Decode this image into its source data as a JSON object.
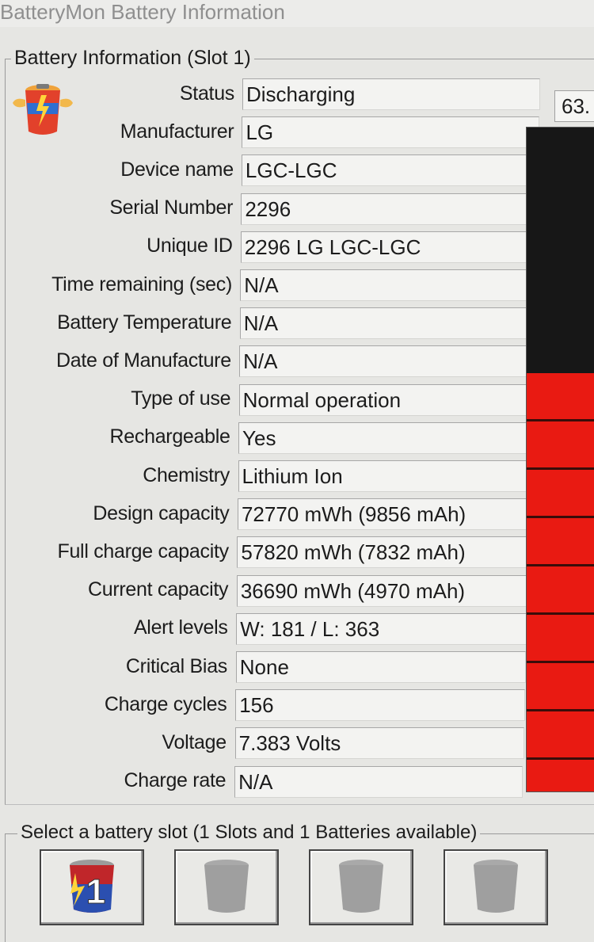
{
  "window": {
    "title": "BatteryMon Battery Information"
  },
  "info_group": {
    "title": "Battery Information (Slot 1)"
  },
  "percentage": "63.",
  "charge_level": 0.63,
  "fields": [
    {
      "label": "Status",
      "value": "Discharging"
    },
    {
      "label": "Manufacturer",
      "value": "LG"
    },
    {
      "label": "Device name",
      "value": "LGC-LGC"
    },
    {
      "label": "Serial Number",
      "value": "2296"
    },
    {
      "label": "Unique ID",
      "value": "2296 LG LGC-LGC"
    },
    {
      "label": "Time remaining (sec)",
      "value": "N/A"
    },
    {
      "label": "Battery Temperature",
      "value": "N/A"
    },
    {
      "label": "Date of Manufacture",
      "value": "N/A"
    },
    {
      "label": "Type of use",
      "value": "Normal operation"
    },
    {
      "label": "Rechargeable",
      "value": "Yes"
    },
    {
      "label": "Chemistry",
      "value": "Lithium Ion"
    },
    {
      "label": "Design capacity",
      "value": "72770 mWh (9856 mAh)"
    },
    {
      "label": "Full charge capacity",
      "value": "57820 mWh (7832 mAh)"
    },
    {
      "label": "Current capacity",
      "value": "36690 mWh (4970 mAh)"
    },
    {
      "label": "Alert levels",
      "value": "W: 181 / L: 363"
    },
    {
      "label": "Critical Bias",
      "value": "None"
    },
    {
      "label": "Charge cycles",
      "value": "156"
    },
    {
      "label": "Voltage",
      "value": "7.383 Volts"
    },
    {
      "label": "Charge rate",
      "value": "N/A"
    }
  ],
  "slot_group": {
    "title": "Select a battery slot (1 Slots and 1 Batteries available)",
    "slots": [
      {
        "number": "1",
        "active": true
      },
      {
        "number": "",
        "active": false
      },
      {
        "number": "",
        "active": false
      },
      {
        "number": "",
        "active": false
      }
    ]
  },
  "icons": {
    "app": "battery-character-icon",
    "slot_active": "battery-slot-1-icon",
    "slot_empty": "battery-slot-empty-icon"
  }
}
